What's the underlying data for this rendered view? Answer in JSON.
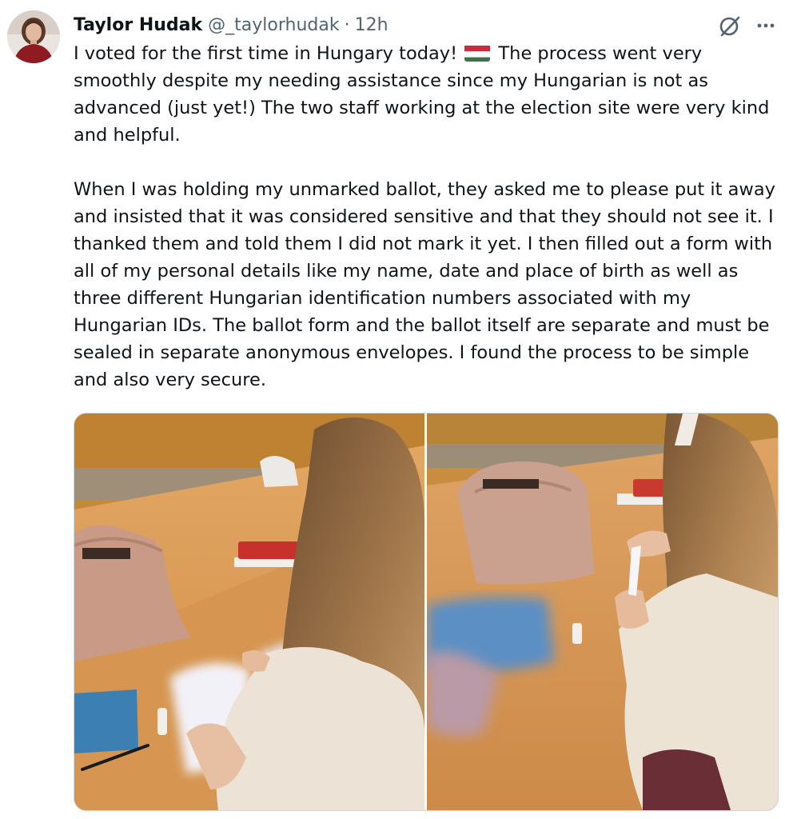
{
  "tweet": {
    "author": {
      "display_name": "Taylor Hudak",
      "handle": "@_taylorhudak",
      "separator": "·",
      "time": "12h"
    },
    "text": {
      "p1_before_flag": "I voted for the first time in Hungary today!",
      "p1_after_flag": " The process went very smoothly despite my needing assistance since my Hungarian is not as advanced (just yet!) The two staff working at the election site were very kind and helpful.",
      "p2": "When I was holding my unmarked ballot, they asked me to please put it away and insisted that it was considered sensitive and that they should not see it. I thanked them and told them I did not mark it yet. I then filled out a form with all of my personal details like my name, date and place of birth as well as three different Hungarian identification numbers associated with my Hungarian IDs. The ballot form and the ballot itself are separate and must be sealed in separate anonymous envelopes. I found the process to be simple and also very secure."
    },
    "icons": {
      "flag": "hungary-flag-emoji",
      "grok": "grok-icon",
      "more": "more-icon"
    },
    "colors": {
      "text_primary": "#0f1419",
      "text_secondary": "#536471",
      "border": "#cfd9de",
      "flag_red": "#cd2a3e",
      "flag_white": "#ffffff",
      "flag_green": "#436f4d"
    },
    "media": {
      "count": 2,
      "photos": [
        "photo-1",
        "photo-2"
      ]
    }
  }
}
